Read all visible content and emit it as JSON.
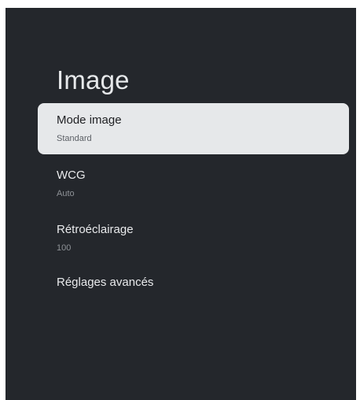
{
  "page": {
    "title": "Image"
  },
  "settings": {
    "items": [
      {
        "label": "Mode image",
        "value": "Standard",
        "focused": true
      },
      {
        "label": "WCG",
        "value": "Auto"
      },
      {
        "label": "Rétroéclairage",
        "value": "100"
      },
      {
        "label": "Réglages avancés"
      }
    ]
  },
  "colors": {
    "background": "#24272c",
    "focus_highlight": "#e6e8ea",
    "primary_text": "#e9eaec",
    "secondary_text": "#8e9297"
  }
}
